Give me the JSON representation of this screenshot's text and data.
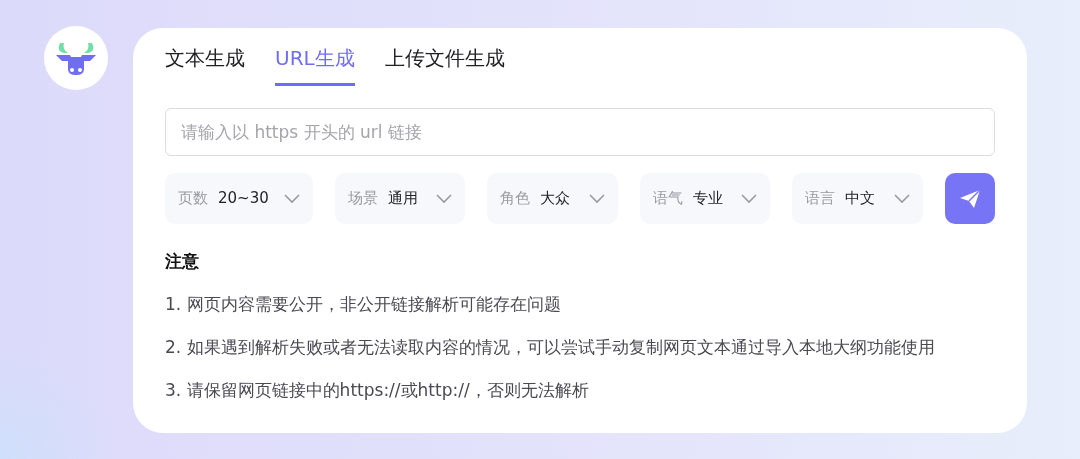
{
  "tabs": [
    {
      "label": "文本生成",
      "selected": false
    },
    {
      "label": "URL生成",
      "selected": true
    },
    {
      "label": "上传文件生成",
      "selected": false
    }
  ],
  "url_field": {
    "placeholder": "请输入以 https 开头的 url 链接"
  },
  "options": [
    {
      "label": "页数",
      "value": "20~30"
    },
    {
      "label": "场景",
      "value": "通用"
    },
    {
      "label": "角色",
      "value": "大众"
    },
    {
      "label": "语气",
      "value": "专业"
    },
    {
      "label": "语言",
      "value": "中文"
    }
  ],
  "notes": {
    "title": "注意",
    "items": [
      "1. 网页内容需要公开，非公开链接解析可能存在问题",
      "2. 如果遇到解析失败或者无法读取内容的情况，可以尝试手动复制网页文本通过导入本地大纲功能使用",
      "3. 请保留网页链接中的https://或http://，否则无法解析"
    ]
  }
}
